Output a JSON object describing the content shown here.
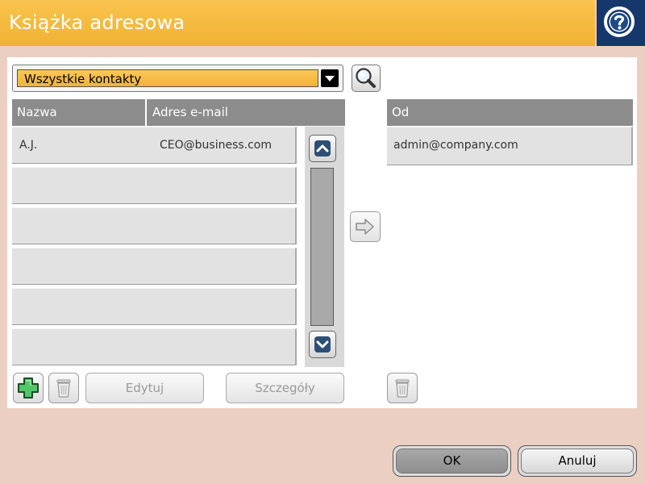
{
  "header": {
    "title": "Książka adresowa",
    "help_icon": "question-mark-icon"
  },
  "filter": {
    "selected": "Wszystkie kontakty",
    "search_icon": "magnifier-icon"
  },
  "contacts": {
    "columns": [
      "Nazwa",
      "Adres e-mail"
    ],
    "rows": [
      {
        "name": "A.J.",
        "email": "CEO@business.com"
      },
      {
        "name": "",
        "email": ""
      },
      {
        "name": "",
        "email": ""
      },
      {
        "name": "",
        "email": ""
      },
      {
        "name": "",
        "email": ""
      },
      {
        "name": "",
        "email": ""
      }
    ]
  },
  "from": {
    "header": "Od",
    "value": "admin@company.com"
  },
  "actions": {
    "edit": "Edytuj",
    "details": "Szczegóły"
  },
  "footer": {
    "ok": "OK",
    "cancel": "Anuluj"
  },
  "colors": {
    "accent": "#f0b233",
    "help_background": "#15376b",
    "page_background": "#eccfc3"
  }
}
